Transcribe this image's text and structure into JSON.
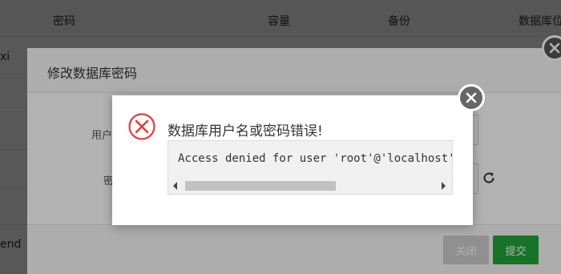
{
  "table": {
    "headers": [
      "密码",
      "容量",
      "备份",
      "数据库位"
    ],
    "row_fragments": [
      "xi",
      "end"
    ]
  },
  "modal": {
    "title": "修改数据库密码",
    "username_label": "用户",
    "password_label": "密",
    "close_label": "关闭",
    "submit_label": "提交"
  },
  "error": {
    "message": "数据库用户名或密码错误!",
    "code": "Access denied for user 'root'@'localhost'"
  },
  "colors": {
    "submit": "#20a53a",
    "error_icon": "#e23c3c"
  }
}
